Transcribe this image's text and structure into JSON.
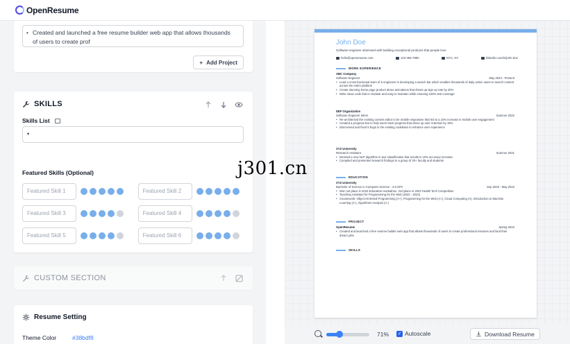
{
  "header": {
    "app_name": "OpenResume"
  },
  "project_card": {
    "bullet_text": "Created and launched a free resume builder web app that allows thousands of users to create prof",
    "add_label": "Add Project"
  },
  "skills": {
    "title": "SKILLS",
    "list_label": "Skills List",
    "list_value": "•",
    "featured_label": "Featured Skills (Optional)",
    "featured": [
      {
        "placeholder": "Featured Skill 1",
        "rating": 5
      },
      {
        "placeholder": "Featured Skill 2",
        "rating": 5
      },
      {
        "placeholder": "Featured Skill 3",
        "rating": 4
      },
      {
        "placeholder": "Featured Skill 4",
        "rating": 4
      },
      {
        "placeholder": "Featured Skill 5",
        "rating": 4
      },
      {
        "placeholder": "Featured Skill 6",
        "rating": 4
      }
    ]
  },
  "custom": {
    "title": "CUSTOM SECTION"
  },
  "settings": {
    "title": "Resume Setting",
    "theme_label": "Theme Color",
    "theme_value": "#38bdf8"
  },
  "resume": {
    "name": "John Doe",
    "summary": "Software engineer obsessed with building exceptional products that people love",
    "contacts": [
      "hello@openresume.com",
      "123-456-7890",
      "NYC, NY",
      "linkedin.com/in/john-doe"
    ],
    "sections": {
      "work": "WORK EXPERIENCE",
      "education": "EDUCATION",
      "project": "PROJECT",
      "skills": "SKILLS"
    },
    "work": [
      {
        "company": "ABC Company",
        "title": "Software Engineer",
        "date": "May 2023 - Present",
        "bullets": [
          "Lead a cross-functional team of 5 engineers in developing a search bar which enables thousands of daily active users to search content across the entire platform",
          "Create stunning home page product demo animations that drives up sign up rate by 20%",
          "Write clean code that is modular and easy to maintain while ensuring 100% test coverage"
        ]
      },
      {
        "company": "DEF Organization",
        "title": "Software Engineer Intern",
        "date": "Summer 2022",
        "bullets": [
          "Re-architected the existing content editor to be mobile responsive that led to a 10% increase in mobile user engagement",
          "Created a progress bar to help users track progress that drove up user retention by 15%",
          "Discovered and fixed 5 bugs in the existing codebase to enhance user experience"
        ]
      },
      {
        "company": "XYZ University",
        "title": "Research Assistant",
        "date": "Summer 2021",
        "bullets": [
          "Devised a new NLP algorithm in text classification that results in 10% accuracy increase",
          "Compiled and presented research findings to a group of 20+ faculty and students"
        ]
      }
    ],
    "education": {
      "school": "XYZ University",
      "degree": "Bachelor of Science in Computer Science - 3.8 GPA",
      "date": "Sep 2019 - May 2023",
      "bullets": [
        "Won 1st place in 2022 Education Hackathon, 2nd place in 2023 Health Tech Competition",
        "Teaching Assistant for Programming for the Web (2022 - 2023)",
        "Coursework: Object-Oriented Programming (A+), Programming for the Web (A+), Cloud Computing (A), Introduction to Machine Learning (A-), Algorithms Analysis (A-)"
      ]
    },
    "project": {
      "name": "OpenResume",
      "date": "Spring 2023",
      "bullets": [
        "Created and launched a free resume builder web app that allows thousands of users to create professional resumes and land their dream jobs"
      ]
    }
  },
  "toolbar": {
    "zoom": "71%",
    "autoscale_label": "Autoscale",
    "download_label": "Download Resume"
  },
  "watermark": "j301.cn"
}
